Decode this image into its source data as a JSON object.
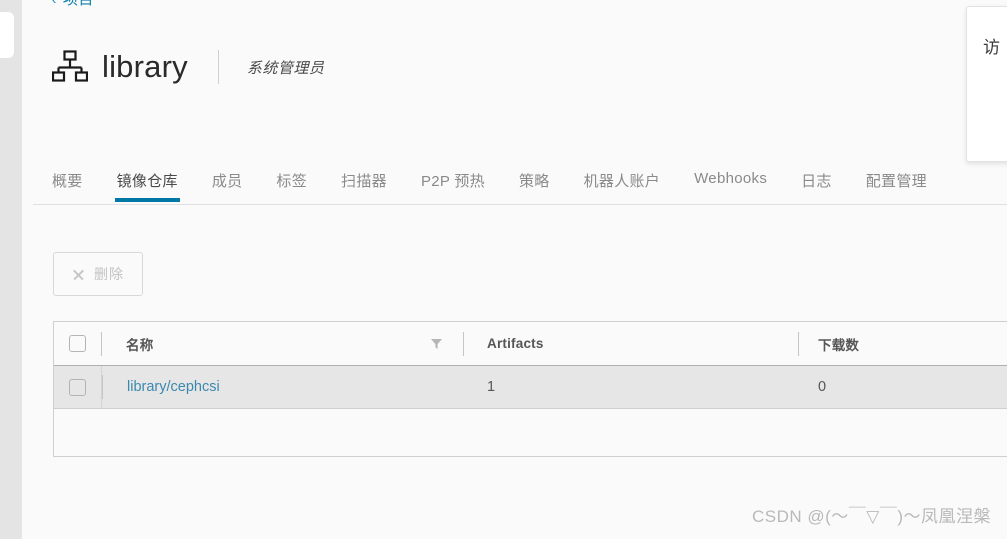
{
  "breadcrumb": {
    "chevron": "‹",
    "label": "项目"
  },
  "header": {
    "icon": "hierarchy-icon",
    "project_name": "library",
    "role": "系统管理员"
  },
  "tabs": [
    {
      "label": "概要",
      "active": false
    },
    {
      "label": "镜像仓库",
      "active": true
    },
    {
      "label": "成员",
      "active": false
    },
    {
      "label": "标签",
      "active": false
    },
    {
      "label": "扫描器",
      "active": false
    },
    {
      "label": "P2P 预热",
      "active": false
    },
    {
      "label": "策略",
      "active": false
    },
    {
      "label": "机器人账户",
      "active": false
    },
    {
      "label": "Webhooks",
      "active": false
    },
    {
      "label": "日志",
      "active": false
    },
    {
      "label": "配置管理",
      "active": false
    }
  ],
  "toolbar": {
    "delete_label": "删除",
    "delete_icon": "close-x-icon",
    "delete_disabled": true
  },
  "table": {
    "columns": [
      {
        "key": "select",
        "label": ""
      },
      {
        "key": "name",
        "label": "名称",
        "filter_icon": "funnel-filter-icon"
      },
      {
        "key": "artifacts",
        "label": "Artifacts"
      },
      {
        "key": "downloads",
        "label": "下载数"
      }
    ],
    "rows": [
      {
        "name": "library/cephcsi",
        "artifacts": "1",
        "downloads": "0",
        "selected": false,
        "highlighted": true
      }
    ]
  },
  "popup_panel": {
    "visible_text": "访"
  },
  "watermark": {
    "text": "CSDN @(～￣▽￣)～凤凰涅槃"
  },
  "colors": {
    "accent": "#0078a6",
    "link": "#3b89af",
    "page_bg": "#fafafa",
    "row_highlight": "#e6e6e6",
    "rail": "#e4e4e4"
  }
}
